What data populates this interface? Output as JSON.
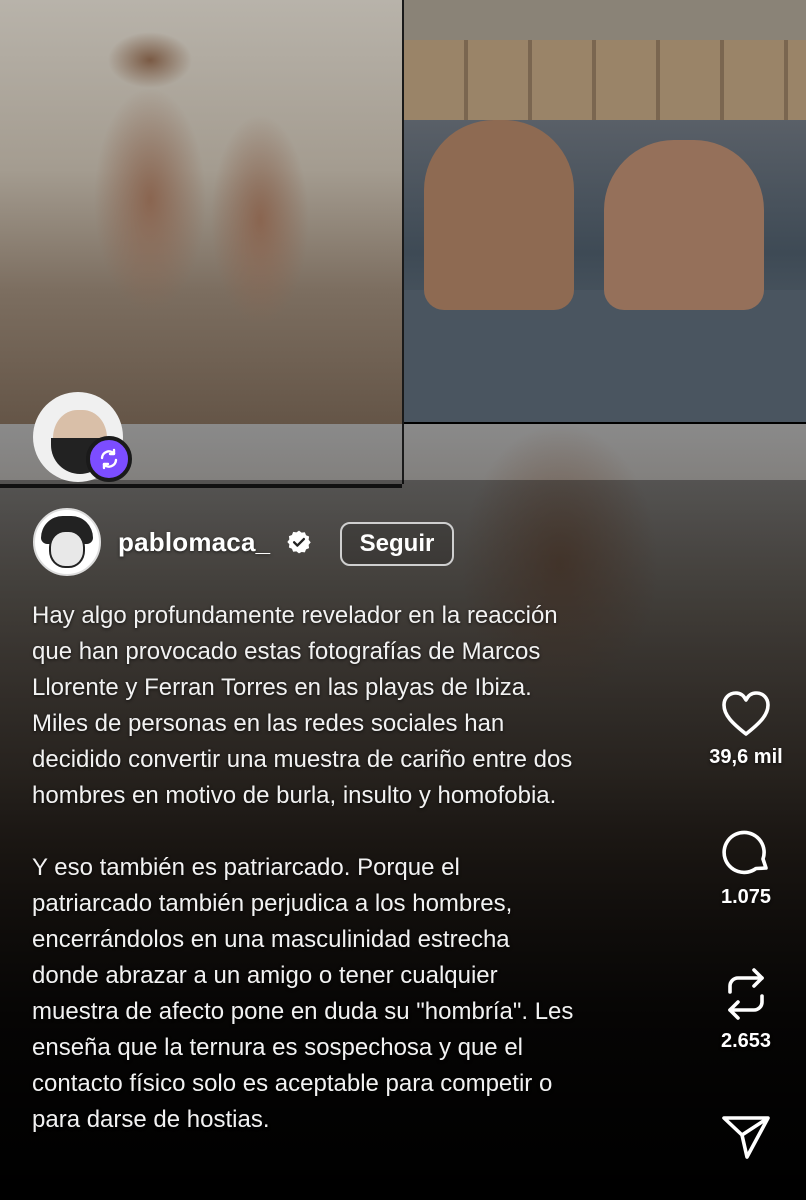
{
  "post": {
    "author": {
      "username": "pablomaca_",
      "verified": true,
      "follow_label": "Seguir"
    },
    "reposter_badge_icon": "repost-icon",
    "caption_paragraphs": [
      "Hay algo profundamente revelador en la reacción\nque han provocado estas fotografías de Marcos\nLlorente y Ferran Torres en las playas de Ibiza.\nMiles de personas en las redes sociales han\ndecidido convertir una muestra de cariño entre dos\nhombres en motivo de burla, insulto y homofobia.",
      "Y eso también es patriarcado. Porque el\npatriarcado también perjudica a los hombres,\nencerrándolos en una masculinidad estrecha\ndonde abrazar a un amigo o tener cualquier\nmuestra de afecto pone en duda su \"hombría\". Les\nenseña que la ternura es sospechosa y que el\ncontacto físico solo es aceptable para competir o\npara darse de hostias."
    ]
  },
  "actions": {
    "like": {
      "icon": "heart-icon",
      "count": "39,6 mil"
    },
    "comment": {
      "icon": "comment-icon",
      "count": "1.075"
    },
    "repost": {
      "icon": "repost-icon",
      "count": "2.653"
    },
    "share": {
      "icon": "send-icon"
    }
  },
  "colors": {
    "repost_badge": "#7c4dff",
    "verified_badge": "#ffffff",
    "follow_border": "#cfcfcf"
  }
}
